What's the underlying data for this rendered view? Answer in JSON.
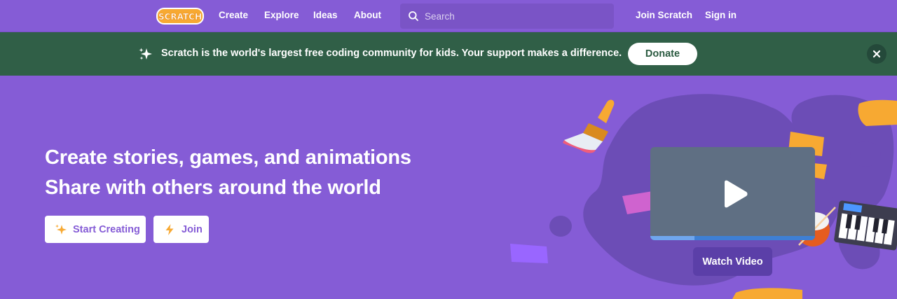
{
  "nav": {
    "logo_text": "SCRATCH",
    "links": [
      "Create",
      "Explore",
      "Ideas",
      "About"
    ],
    "search_placeholder": "Search",
    "join": "Join Scratch",
    "signin": "Sign in"
  },
  "banner": {
    "message": "Scratch is the world's largest free coding community for kids. Your support makes a difference.",
    "donate": "Donate",
    "close_icon": "close-icon"
  },
  "hero": {
    "line1": "Create stories, games, and animations",
    "line2": "Share with others around the world",
    "start_creating": "Start Creating",
    "join": "Join",
    "watch_video": "Watch Video",
    "video_progress": 0.27
  },
  "colors": {
    "brand_purple": "#855cd6",
    "banner_green": "#305f47",
    "scratch_orange": "#f7a932",
    "donate_text": "#2a5a40"
  }
}
